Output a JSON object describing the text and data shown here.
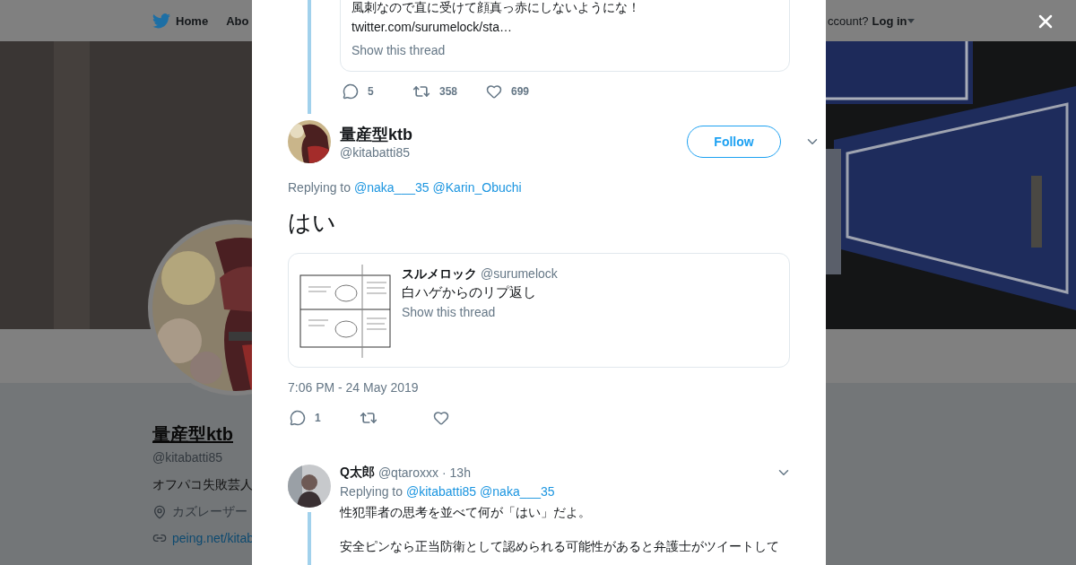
{
  "header": {
    "nav": [
      {
        "label": "Home"
      },
      {
        "label": "Abo"
      }
    ],
    "account_prompt": "ccount?",
    "login": "Log in"
  },
  "profile": {
    "name": "量産型ktb",
    "handle": "@kitabatti85",
    "bio": "オフパコ失敗芸人",
    "location": "カズレーザー",
    "link": "peing.net/kitab"
  },
  "parent_tweet": {
    "quote_lines": [
      "風刺なので直に受けて顔真っ赤にしないようにな！",
      "twitter.com/surumelock/sta…"
    ],
    "show_thread": "Show this thread",
    "replies": "5",
    "retweets": "358",
    "likes": "699"
  },
  "tweet": {
    "name": "量産型ktb",
    "handle": "@kitabatti85",
    "follow": "Follow",
    "replying_label": "Replying to",
    "mentions": [
      "@naka___35",
      "@Karin_Obuchi"
    ],
    "text": "はい",
    "quote": {
      "name": "スルメロック",
      "handle": "@surumelock",
      "text": "白ハゲからのリプ返し",
      "show_thread": "Show this thread"
    },
    "timestamp": "7:06 PM - 24 May 2019",
    "replies": "1"
  },
  "replies": [
    {
      "name": "Q太郎",
      "handle": "@qtaroxxx",
      "time": "· 13h",
      "replying_label": "Replying to",
      "mentions": [
        "@kitabatti85",
        "@naka___35"
      ],
      "paragraphs": [
        "性犯罪者の思考を並べて何が「はい」だよ。",
        "安全ピンなら正当防衛として認められる可能性があると弁護士がツイートして"
      ]
    }
  ]
}
